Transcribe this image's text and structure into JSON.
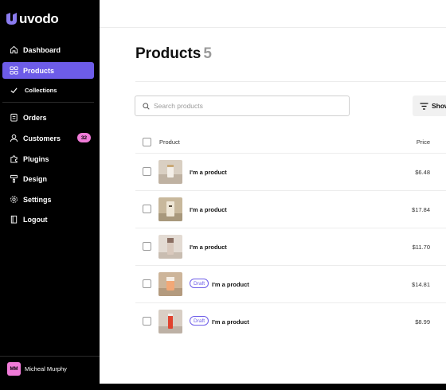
{
  "brand": {
    "name": "uvodo",
    "accent": "#6d5ce8",
    "badge_color": "#f07bd8"
  },
  "sidebar": {
    "items": [
      {
        "label": "Dashboard",
        "icon": "home-icon"
      },
      {
        "label": "Products",
        "icon": "grid-icon",
        "active": true
      },
      {
        "label": "Collections",
        "icon": "check-icon",
        "sub": true
      },
      {
        "label": "Orders",
        "icon": "clipboard-icon"
      },
      {
        "label": "Customers",
        "icon": "user-icon",
        "badge": "32"
      },
      {
        "label": "Plugins",
        "icon": "puzzle-icon"
      },
      {
        "label": "Design",
        "icon": "paint-roller-icon"
      },
      {
        "label": "Settings",
        "icon": "gear-icon"
      },
      {
        "label": "Logout",
        "icon": "logout-icon"
      }
    ],
    "user": {
      "initials": "MM",
      "name": "Micheal Murphy"
    }
  },
  "main": {
    "title": "Products",
    "count": "5",
    "search": {
      "placeholder": "Search products"
    },
    "show_label": "Show",
    "columns": {
      "product": "Product",
      "price": "Price"
    },
    "rows": [
      {
        "name": "I'm a product",
        "price": "$6.48",
        "draft": false
      },
      {
        "name": "I'm a product",
        "price": "$17.84",
        "draft": false
      },
      {
        "name": "I'm a product",
        "price": "$11.70",
        "draft": false
      },
      {
        "name": "I'm a product",
        "price": "$14.81",
        "draft": true,
        "draft_label": "Draft"
      },
      {
        "name": "I'm a product",
        "price": "$8.99",
        "draft": true,
        "draft_label": "Draft"
      }
    ]
  }
}
